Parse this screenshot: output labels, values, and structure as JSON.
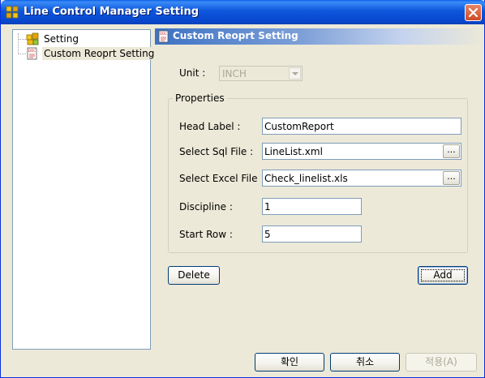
{
  "window": {
    "title": "Line Control Manager Setting",
    "icons": {
      "app": "app-grid-icon",
      "close": "close-icon"
    }
  },
  "tree": {
    "items": [
      {
        "label": "Setting",
        "icon": "settings-folder-icon"
      },
      {
        "label": "Custom Reoprt Setting",
        "icon": "report-doc-icon",
        "selected": true
      }
    ]
  },
  "panel": {
    "header": "Custom Reoprt Setting",
    "unit": {
      "label": "Unit :",
      "value": "INCH",
      "disabled": true
    },
    "properties": {
      "title": "Properties",
      "head_label": {
        "label": "Head Label :",
        "value": "CustomReport"
      },
      "select_sql_file": {
        "label": "Select Sql File :",
        "value": "LineList.xml",
        "browse": "..."
      },
      "select_excel_file": {
        "label": "Select Excel File",
        "value": "Check_linelist.xls",
        "browse": "..."
      },
      "discipline": {
        "label": "Discipline :",
        "value": "1"
      },
      "start_row": {
        "label": "Start Row :",
        "value": "5"
      }
    },
    "delete_label": "Delete",
    "add_label": "Add"
  },
  "footer": {
    "ok_label": "확인",
    "cancel_label": "취소",
    "apply_label": "적용(A)"
  },
  "colors": {
    "titlebar": "#0a5fe8",
    "header_gradient_start": "#3c72c4",
    "dialog_bg": "#ece9d8"
  }
}
